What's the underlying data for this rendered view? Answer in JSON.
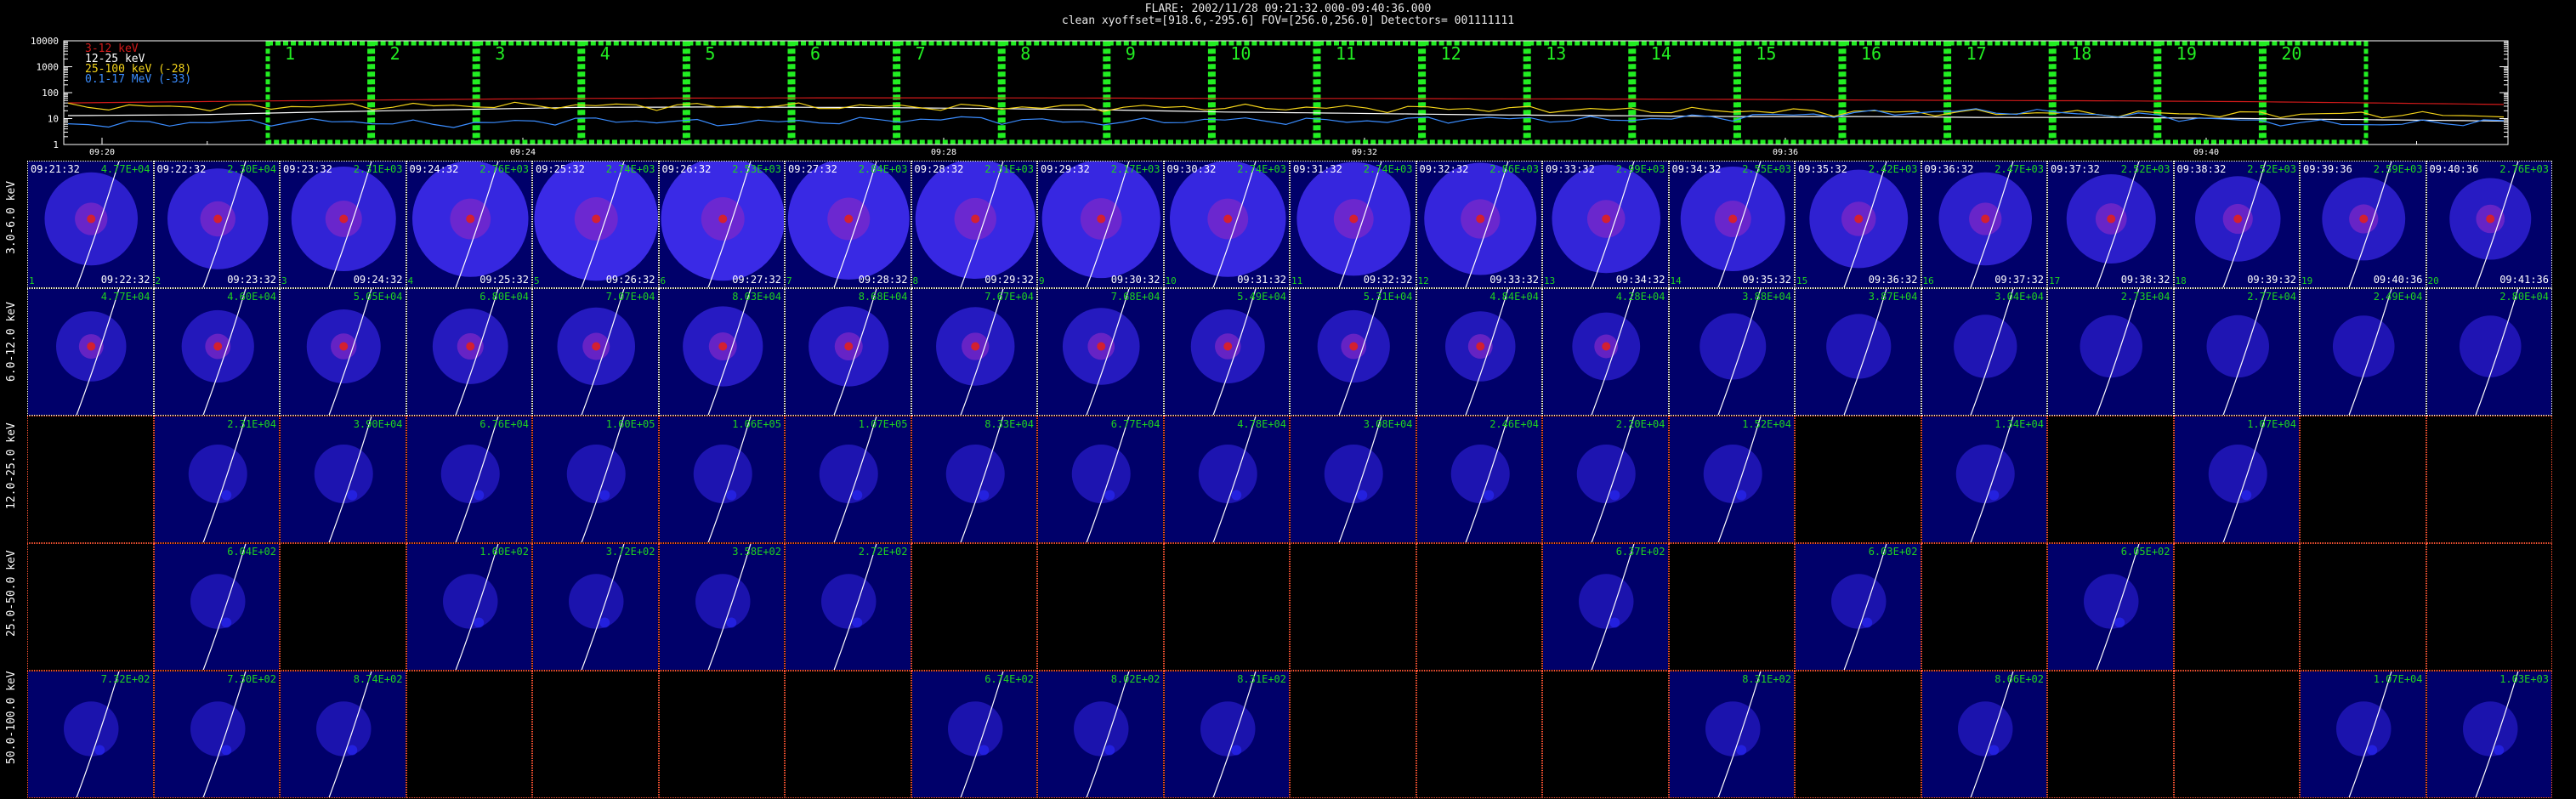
{
  "header": {
    "line1": "FLARE: 2002/11/28 09:21:32.000-09:40:36.000",
    "line2": "clean    xyoffset=[918.6,-295.6]    FOV=[256.0,256.0]    Detectors= 001111111"
  },
  "chart_data": [
    {
      "type": "line",
      "yscale": "log",
      "ylim": [
        1,
        10000
      ],
      "ytick_labels": [
        "10000",
        "1000",
        "100",
        "10",
        "1"
      ],
      "xtick_labels": [
        "09:20",
        "09:24",
        "09:28",
        "09:32",
        "09:36",
        "09:40"
      ],
      "legend": [
        {
          "label": "3-12 keV",
          "color": "#d11a1a"
        },
        {
          "label": "12-25 keV",
          "color": "#ffffff"
        },
        {
          "label": "25-100 keV (-28)",
          "color": "#f3d31a"
        },
        {
          "label": "0.1-17 MeV (-33)",
          "color": "#3b8dff"
        }
      ],
      "intervals": [
        "1",
        "2",
        "3",
        "4",
        "5",
        "6",
        "7",
        "8",
        "9",
        "10",
        "11",
        "12",
        "13",
        "14",
        "15",
        "16",
        "17",
        "18",
        "19",
        "20"
      ],
      "series": [
        {
          "name": "3-12 keV",
          "color": "#d11a1a",
          "values": [
            40,
            45,
            50,
            55,
            60,
            62,
            63,
            63,
            62,
            60,
            60,
            58,
            57,
            55,
            52,
            50,
            48,
            45,
            40,
            35
          ]
        },
        {
          "name": "12-25 keV",
          "color": "#ffffff",
          "values": [
            13,
            14,
            18,
            22,
            27,
            28,
            27,
            25,
            22,
            18,
            16,
            14,
            13,
            12,
            12,
            11,
            11,
            10,
            9,
            8
          ]
        },
        {
          "name": "25-100 keV (-28)",
          "color": "#f3d31a",
          "values": [
            30,
            28,
            30,
            32,
            32,
            31,
            30,
            28,
            28,
            27,
            26,
            24,
            22,
            20,
            18,
            17,
            16,
            15,
            15,
            13
          ]
        },
        {
          "name": "0.1-17 MeV (-33)",
          "color": "#3b8dff",
          "values": [
            6,
            7,
            8,
            6,
            9,
            7,
            8,
            10,
            7,
            9,
            8,
            10,
            9,
            12,
            16,
            20,
            14,
            8,
            6,
            8
          ]
        }
      ]
    },
    {
      "type": "heatmap",
      "rows": [
        "3.0-6.0 keV",
        "6.0-12.0 keV",
        "12.0-25.0 keV",
        "25.0-50.0 keV",
        "50.0-100.0 keV"
      ],
      "columns": [
        {
          "start": "09:21:32",
          "end": "09:22:32"
        },
        {
          "start": "09:22:32",
          "end": "09:23:32"
        },
        {
          "start": "09:23:32",
          "end": "09:24:32"
        },
        {
          "start": "09:24:32",
          "end": "09:25:32"
        },
        {
          "start": "09:25:32",
          "end": "09:26:32"
        },
        {
          "start": "09:26:32",
          "end": "09:27:32"
        },
        {
          "start": "09:27:32",
          "end": "09:28:32"
        },
        {
          "start": "09:28:32",
          "end": "09:29:32"
        },
        {
          "start": "09:29:32",
          "end": "09:30:32"
        },
        {
          "start": "09:30:32",
          "end": "09:31:32"
        },
        {
          "start": "09:31:32",
          "end": "09:32:32"
        },
        {
          "start": "09:32:32",
          "end": "09:33:32"
        },
        {
          "start": "09:33:32",
          "end": "09:34:32"
        },
        {
          "start": "09:34:32",
          "end": "09:35:32"
        },
        {
          "start": "09:35:32",
          "end": "09:36:32"
        },
        {
          "start": "09:36:32",
          "end": "09:37:32"
        },
        {
          "start": "09:37:32",
          "end": "09:38:32"
        },
        {
          "start": "09:38:32",
          "end": "09:39:32"
        },
        {
          "start": "09:39:36",
          "end": "09:40:36"
        },
        {
          "start": "09:40:36",
          "end": "09:41:36"
        }
      ],
      "maxima": [
        [
          "4.77E+04",
          "2.30E+04",
          "2.31E+03",
          "2.76E+03",
          "2.74E+03",
          "2.53E+03",
          "2.84E+03",
          "2.31E+03",
          "2.17E+03",
          "2.74E+03",
          "2.74E+03",
          "2.86E+03",
          "2.99E+03",
          "2.55E+03",
          "2.42E+03",
          "2.47E+03",
          "2.52E+03",
          "2.52E+03",
          "2.59E+03",
          "2.76E+03"
        ],
        [
          "4.77E+04",
          "4.60E+04",
          "5.05E+04",
          "6.80E+04",
          "7.07E+04",
          "8.03E+04",
          "8.68E+04",
          "7.67E+04",
          "7.68E+04",
          "5.49E+04",
          "5.31E+04",
          "4.84E+04",
          "4.28E+04",
          "3.88E+04",
          "3.87E+04",
          "3.04E+04",
          "2.73E+04",
          "2.77E+04",
          "2.49E+04",
          "2.80E+04"
        ],
        [
          "",
          "2.31E+04",
          "3.90E+04",
          "6.76E+04",
          "1.60E+05",
          "1.06E+05",
          "1.07E+05",
          "8.33E+04",
          "6.77E+04",
          "4.78E+04",
          "3.08E+04",
          "2.46E+04",
          "2.20E+04",
          "1.52E+04",
          "",
          "1.34E+04",
          "",
          "1.07E+04",
          "",
          ""
        ],
        [
          "",
          "6.04E+02",
          "",
          "1.60E+02",
          "3.72E+02",
          "3.58E+02",
          "2.72E+02",
          "",
          "",
          "",
          "",
          "",
          "6.37E+02",
          "",
          "6.03E+02",
          "",
          "6.05E+02",
          "",
          "",
          ""
        ],
        [
          "7.32E+02",
          "7.30E+02",
          "8.74E+02",
          "",
          "",
          "",
          "",
          "6.74E+02",
          "8.02E+02",
          "8.31E+02",
          "",
          "",
          "",
          "8.31E+02",
          "",
          "8.66E+02",
          "",
          "",
          "1.07E+04",
          "1.03E+03"
        ]
      ],
      "intensity": [
        [
          0.55,
          0.65,
          0.7,
          0.85,
          0.95,
          0.95,
          0.92,
          0.9,
          0.88,
          0.85,
          0.82,
          0.8,
          0.75,
          0.7,
          0.62,
          0.55,
          0.5,
          0.45,
          0.42,
          0.4
        ],
        [
          0.25,
          0.28,
          0.3,
          0.32,
          0.35,
          0.38,
          0.38,
          0.36,
          0.34,
          0.3,
          0.28,
          0.25,
          0.22,
          0.2,
          0.18,
          0.16,
          0.15,
          0.15,
          0.14,
          0.14
        ],
        [
          0,
          0.1,
          0.1,
          0.1,
          0.1,
          0.1,
          0.1,
          0.1,
          0.1,
          0.1,
          0.1,
          0.1,
          0.1,
          0.1,
          0,
          0.1,
          0,
          0.1,
          0,
          0
        ],
        [
          0,
          0.05,
          0,
          0.05,
          0.05,
          0.05,
          0.05,
          0,
          0,
          0,
          0,
          0,
          0.05,
          0,
          0.05,
          0,
          0.05,
          0,
          0,
          0
        ],
        [
          0.05,
          0.05,
          0.05,
          0,
          0,
          0,
          0,
          0.05,
          0.05,
          0.05,
          0,
          0,
          0,
          0.05,
          0,
          0.05,
          0,
          0,
          0.05,
          0.05
        ]
      ]
    }
  ]
}
